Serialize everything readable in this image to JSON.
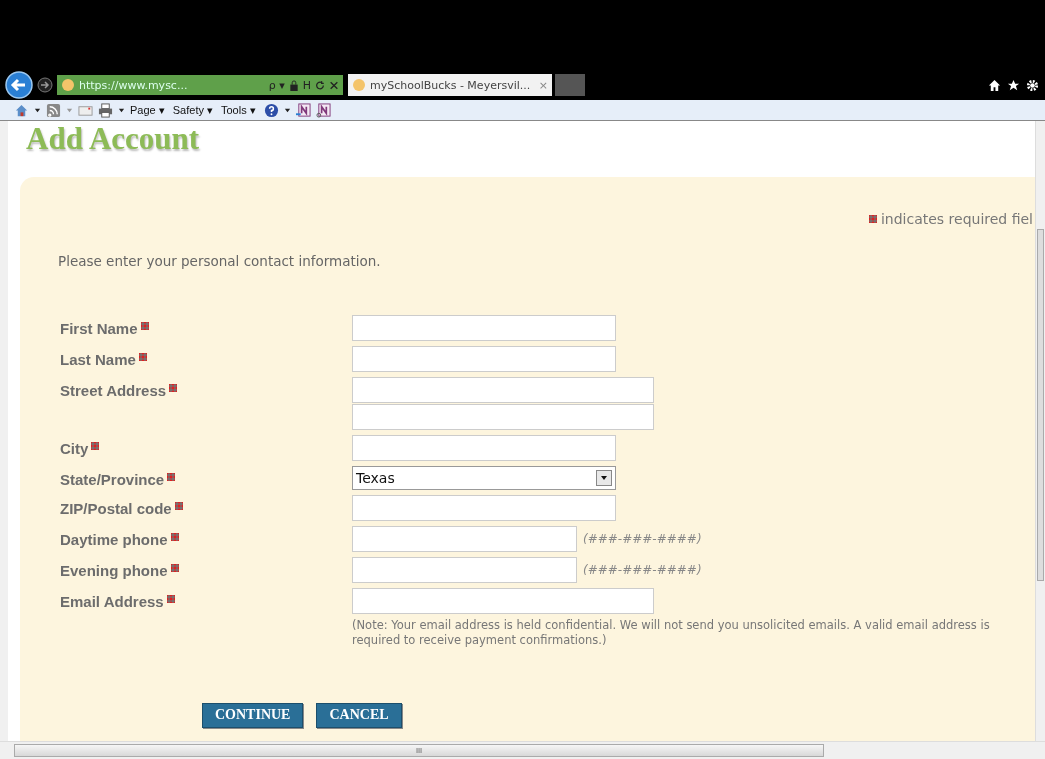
{
  "browser": {
    "address": "https://www.mysc...",
    "address_icons": [
      "ρ ▾",
      "H"
    ],
    "tabs": [
      {
        "title": "mySchoolBucks - Meyersvil...",
        "close": "×",
        "selected": true
      }
    ]
  },
  "command_bar": {
    "menus": [
      "Page ▾",
      "Safety ▾",
      "Tools ▾"
    ]
  },
  "page": {
    "title": "Add Account",
    "required_note": "indicates required fiel",
    "intro": "Please enter your personal contact information.",
    "fields": [
      {
        "label": "First Name",
        "kind": "text",
        "required": true
      },
      {
        "label": "Last Name",
        "kind": "text",
        "required": true
      },
      {
        "label": "Street Address",
        "kind": "address",
        "required": true
      },
      {
        "label": "City",
        "kind": "text",
        "required": true
      },
      {
        "label": "State/Province",
        "kind": "select",
        "value": "Texas",
        "required": true
      },
      {
        "label": "ZIP/Postal code",
        "kind": "text",
        "required": true
      },
      {
        "label": "Daytime phone",
        "kind": "phone",
        "hint": "(###-###-####)",
        "required": true
      },
      {
        "label": "Evening phone",
        "kind": "phone",
        "hint": "(###-###-####)",
        "required": true
      },
      {
        "label": "Email Address",
        "kind": "email",
        "note": "(Note: Your email address is held confidential. We will not send you unsolicited emails. A valid email address is required to receive payment confirmations.)",
        "required": true
      }
    ],
    "buttons": [
      "CONTINUE",
      "CANCEL"
    ],
    "scroll_grip": "III"
  }
}
